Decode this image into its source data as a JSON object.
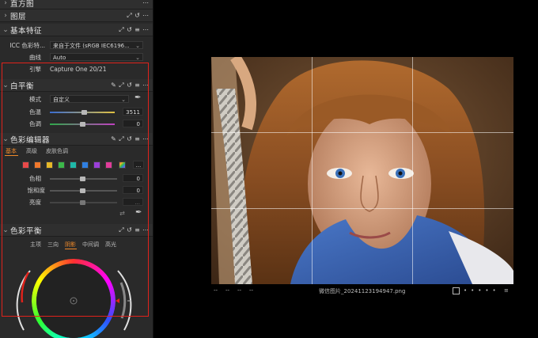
{
  "sections": {
    "histogram": {
      "title": "直方图"
    },
    "layers": {
      "title": "图层"
    },
    "basic": {
      "title": "基本特征",
      "icc_label": "ICC 色彩特...",
      "icc_value": "来自于文件 (sRGB IEC6196...",
      "curve_label": "曲线",
      "curve_value": "Auto",
      "engine_label": "引擎",
      "engine_value": "Capture One 20/21"
    },
    "white_balance": {
      "title": "白平衡",
      "mode_label": "模式",
      "mode_value": "自定义",
      "temp_label": "色温",
      "temp_value": "3511",
      "temp_fraction": 0.52,
      "tint_label": "色调",
      "tint_value": "0",
      "tint_fraction": 0.5
    },
    "color_editor": {
      "title": "色彩编辑器",
      "tabs": [
        "基本",
        "高级",
        "皮肤色调"
      ],
      "active_tab": 0,
      "more_label": "...",
      "swatches": [
        "#e84a4a",
        "#f0782c",
        "#e6b828",
        "#3cb84a",
        "#1fb8a8",
        "#2f7fe0",
        "#9a3fd8",
        "#e03c9a"
      ],
      "hue_label": "色相",
      "hue_value": "0",
      "saturation_label": "饱和度",
      "saturation_value": "0",
      "lightness_label": "亮度",
      "lightness_value": "..."
    },
    "color_balance": {
      "title": "色彩平衡",
      "tabs": [
        "主项",
        "三向",
        "阴影",
        "中间调",
        "高光"
      ],
      "active_tab": 2
    }
  },
  "image": {
    "filename": "微信图片_20241123194947.png",
    "left_dots": [
      "--",
      "--",
      "--",
      "--"
    ]
  },
  "colors": {
    "panel_bg": "#2a2a2a",
    "accent_orange": "#f08a2a",
    "highlight_red": "#e0221b"
  }
}
